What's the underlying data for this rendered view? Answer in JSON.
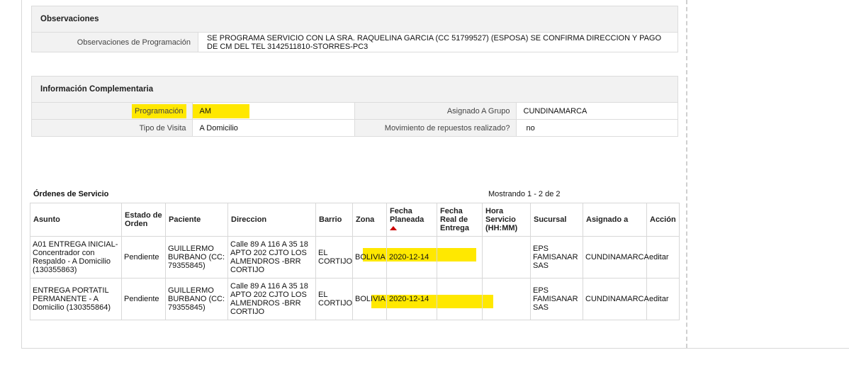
{
  "observaciones": {
    "title": "Observaciones",
    "label": "Observaciones de Programación",
    "value": "SE PROGRAMA SERVICIO CON LA SRA. RAQUELINA GARCIA (CC 51799527) (ESPOSA) SE CONFIRMA DIRECCION Y PAGO DE CM DEL TEL 3142511810-STORRES-PC3"
  },
  "info": {
    "title": "Información Complementaria",
    "programacion_label": "Programación",
    "programacion_value": "AM",
    "grupo_label": "Asignado A Grupo",
    "grupo_value": "CUNDINAMARCA",
    "visita_label": "Tipo de Visita",
    "visita_value": "A Domicilio",
    "repuestos_label": "Movimiento de repuestos realizado?",
    "repuestos_value": "no"
  },
  "orders": {
    "title": "Órdenes de Servicio",
    "count": "Mostrando 1 - 2 de 2",
    "headers": [
      "Asunto",
      "Estado de Orden",
      "Paciente",
      "Direccion",
      "Barrio",
      "Zona",
      "Fecha Planeada",
      "Fecha Real de Entrega",
      "Hora Servicio (HH:MM)",
      "Sucursal",
      "Asignado a",
      "Acción"
    ],
    "rows": [
      {
        "asunto": "A01 ENTREGA INICIAL-Concentrador con Respaldo - A Domicilio (130355863)",
        "estado": "Pendiente",
        "paciente": "GUILLERMO BURBANO (CC: 79355845)",
        "direccion": "Calle 89 A 116 A 35 18 APTO 202 CJTO LOS ALMENDROS -BRR CORTIJO",
        "barrio": "EL CORTIJO",
        "zona": "BOLIVIA",
        "fecha_planeada": "2020-12-14",
        "fecha_real": "",
        "hora": "",
        "sucursal": "EPS FAMISANAR SAS",
        "asignado": "CUNDINAMARCA",
        "accion": "editar"
      },
      {
        "asunto": "ENTREGA PORTATIL PERMANENTE - A Domicilio (130355864)",
        "estado": "Pendiente",
        "paciente": "GUILLERMO BURBANO (CC: 79355845)",
        "direccion": "Calle 89 A 116 A 35 18 APTO 202 CJTO LOS ALMENDROS -BRR CORTIJO",
        "barrio": "EL CORTIJO",
        "zona": "BOLIVIA",
        "fecha_planeada": "2020-12-14",
        "fecha_real": "",
        "hora": "",
        "sucursal": "EPS FAMISANAR SAS",
        "asignado": "CUNDINAMARCA",
        "accion": "editar"
      }
    ]
  },
  "colors": {
    "highlight": "#ffe800",
    "sort_arrow": "#cc0000",
    "header_bg": "#f2f2f2",
    "border": "#dcdcdc"
  },
  "icons": {
    "sort": "sort-up-arrow-icon"
  }
}
